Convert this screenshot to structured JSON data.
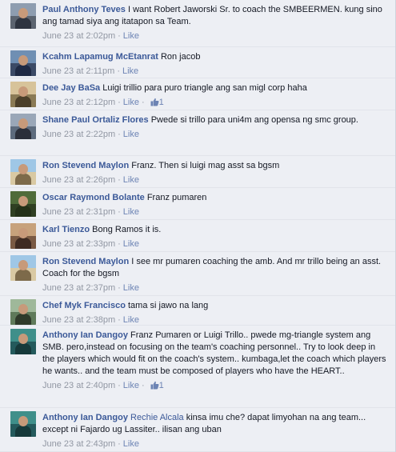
{
  "comments": [
    {
      "author": "Paul Anthony Teves",
      "text": "I want Robert Jaworski Sr. to coach the SMBEERMEN. kung sino ang tamad siya ang itatapon sa Team.",
      "time": "June 23 at 2:02pm",
      "like": "Like"
    },
    {
      "author": "Kcahm Lapamug McEtanrat",
      "text": "Ron jacob",
      "time": "June 23 at 2:11pm",
      "like": "Like"
    },
    {
      "author": "Dee Jay BaSa",
      "text": "Luigi trillio para puro triangle ang san migl corp haha",
      "time": "June 23 at 2:12pm",
      "like": "Like",
      "likes": "1"
    },
    {
      "author": "Shane Paul Ortaliz Flores",
      "text": "Pwede si trillo para uni4m ang opensa ng smc group.",
      "time": "June 23 at 2:22pm",
      "like": "Like"
    },
    {
      "author": "Ron Stevend Maylon",
      "text": "Franz. Then si luigi mag asst sa bgsm",
      "time": "June 23 at 2:26pm",
      "like": "Like"
    },
    {
      "author": "Oscar Raymond Bolante",
      "text": "Franz pumaren",
      "time": "June 23 at 2:31pm",
      "like": "Like"
    },
    {
      "author": "Karl Tienzo",
      "text": "Bong Ramos it is.",
      "time": "June 23 at 2:33pm",
      "like": "Like"
    },
    {
      "author": "Ron Stevend Maylon",
      "text": "I see mr pumaren coaching the amb. And mr trillo being an asst. Coach for the bgsm",
      "time": "June 23 at 2:37pm",
      "like": "Like"
    },
    {
      "author": "Chef Myk Francisco",
      "text": "tama si jawo na lang",
      "time": "June 23 at 2:38pm",
      "like": "Like"
    },
    {
      "author": "Anthony Ian Dangoy",
      "text": "Franz Pumaren or Luigi Trillo.. pwede mg-triangle system ang SMB. pero,instead on focusing on the team's coaching personnel.. Try to look deep in the players which would fit on the coach's system.. kumbaga,let the coach which players he wants.. and the team must be composed of players who have the HEART..",
      "time": "June 23 at 2:40pm",
      "like": "Like",
      "likes": "1"
    },
    {
      "author": "Anthony Ian Dangoy",
      "mention": "Rechie Alcala",
      "text": "kinsa imu che? dapat limyohan na ang team... except ni Fajardo ug Lassiter.. ilisan ang uban",
      "time": "June 23 at 2:43pm",
      "like": "Like"
    }
  ],
  "avatar_colors": [
    {
      "top": "#8e9db0",
      "bottom": "#5c6470",
      "body": "#2e3440"
    },
    {
      "top": "#6f8fb3",
      "bottom": "#3b4a66",
      "body": "#1f2a44"
    },
    {
      "top": "#d7c39a",
      "bottom": "#8a7a55",
      "body": "#4b3f2a"
    },
    {
      "top": "#9aa7b8",
      "bottom": "#5d6b7d",
      "body": "#2b2f3a"
    },
    {
      "top": "#9fc7e6",
      "bottom": "#d9c9a3",
      "body": "#7d6a4a"
    },
    {
      "top": "#4f6b3a",
      "bottom": "#2f3f22",
      "body": "#233018"
    },
    {
      "top": "#c7a27c",
      "bottom": "#7a5a44",
      "body": "#3e2a22"
    },
    {
      "top": "#9fc7e6",
      "bottom": "#d9c9a3",
      "body": "#7d6a4a"
    },
    {
      "top": "#9fb89a",
      "bottom": "#5f7a5a",
      "body": "#2f3a2a"
    },
    {
      "top": "#3f8f8a",
      "bottom": "#245a5c",
      "body": "#16393a"
    },
    {
      "top": "#3f8f8a",
      "bottom": "#245a5c",
      "body": "#16393a"
    }
  ]
}
